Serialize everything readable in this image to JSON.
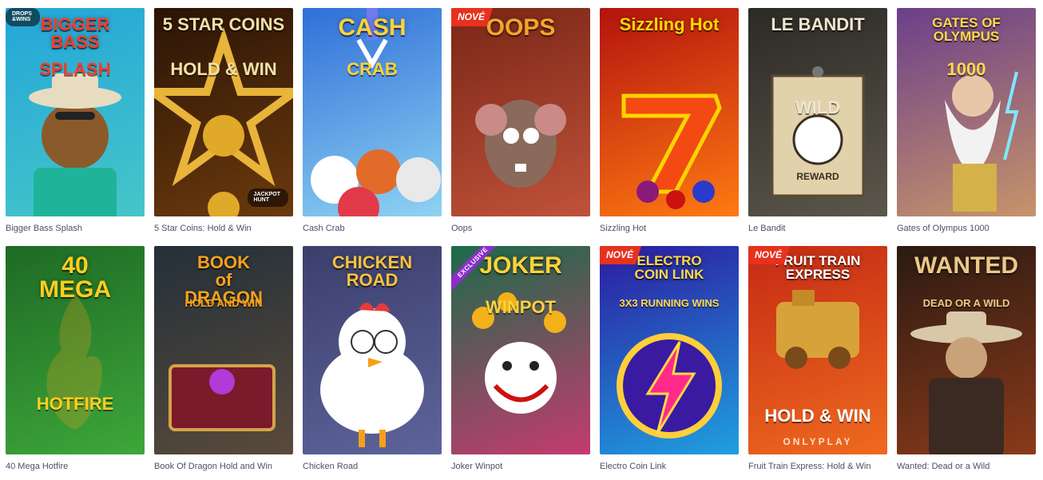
{
  "games": [
    {
      "id": "bigger-bass-splash",
      "name": "Bigger Bass Splash",
      "art_title": "BIGGER\nBASS",
      "art_sub": "SPLASH",
      "badge": "DROPS\n&WINS",
      "bg": "#23a6d9",
      "bg2": "#46c6c9",
      "title_color": "#f63d2b",
      "icon": "fisherman-icon"
    },
    {
      "id": "5-star-coins",
      "name": "5 Star Coins: Hold & Win",
      "art_title": "5 STAR COINS",
      "art_sub": "HOLD & WIN",
      "badge": "JACKPOT\nHUNT",
      "bg": "#2b1406",
      "bg2": "#6b3a0d",
      "title_color": "#f1e0a6",
      "icon": "star-icon"
    },
    {
      "id": "cash-crab",
      "name": "Cash Crab",
      "art_title": "CASH",
      "art_sub": "CRAB",
      "bg": "#2f6fd8",
      "bg2": "#8fd3f2",
      "title_color": "#ffd23a",
      "icon": "claw-icon"
    },
    {
      "id": "oops",
      "name": "Oops",
      "art_title": "OOPS",
      "badge": "NOVÉ",
      "bg": "#7a2616",
      "bg2": "#c0523a",
      "title_color": "#f2a52c",
      "icon": "rat-icon"
    },
    {
      "id": "sizzling-hot",
      "name": "Sizzling Hot",
      "art_title": "Sizzling Hot",
      "bg": "#b3130e",
      "bg2": "#ff7a12",
      "title_color": "#ffd600",
      "icon": "seven-icon"
    },
    {
      "id": "le-bandit",
      "name": "Le Bandit",
      "art_title": "LE BANDIT",
      "art_sub": "WILD",
      "art_sub2": "REWARD",
      "bg": "#2c2a25",
      "bg2": "#5b574c",
      "title_color": "#f0e6d0",
      "icon": "wanted-poster-icon"
    },
    {
      "id": "gates-of-olympus-1000",
      "name": "Gates of Olympus 1000",
      "art_title": "GATES OF OLYMPUS",
      "art_sub": "1000",
      "bg": "#6b3f8a",
      "bg2": "#c7946a",
      "title_color": "#ffd84a",
      "icon": "zeus-icon"
    },
    {
      "id": "40-mega-hotfire",
      "name": "40 Mega Hotfire",
      "art_title": "40\nMEGA",
      "art_sub": "HOTFIRE",
      "bg": "#1e6a25",
      "bg2": "#3ea73a",
      "title_color": "#ffce1f",
      "icon": "fire-icon"
    },
    {
      "id": "book-of-dragon",
      "name": "Book Of Dragon Hold and Win",
      "art_title": "BOOK\nof\nDRAGON",
      "art_sub": "HOLD AND WIN",
      "bg": "#23303a",
      "bg2": "#5a4a3a",
      "title_color": "#f7a21b",
      "icon": "book-icon"
    },
    {
      "id": "chicken-road",
      "name": "Chicken Road",
      "art_title": "CHICKEN\nROAD",
      "bg": "#3b3f6c",
      "bg2": "#5e649b",
      "title_color": "#f8c23d",
      "icon": "chicken-icon"
    },
    {
      "id": "joker-winpot",
      "name": "Joker Winpot",
      "art_title": "JOKER",
      "art_sub": "WINPOT",
      "badge": "EXCLUSIVE",
      "bg": "#1c6b4a",
      "bg2": "#c43b6f",
      "title_color": "#ffd23a",
      "icon": "joker-icon"
    },
    {
      "id": "electro-coin-link",
      "name": "Electro Coin Link",
      "art_title": "ELECTRO\nCOIN LINK",
      "art_sub": "3X3 RUNNING WINS",
      "badge": "NOVÉ",
      "bg": "#2c1aa0",
      "bg2": "#1fa0e0",
      "title_color": "#ffd84a",
      "icon": "lightning-icon"
    },
    {
      "id": "fruit-train-express",
      "name": "Fruit Train Express: Hold & Win",
      "art_title": "FRUIT TRAIN\nEXPRESS",
      "art_sub": "HOLD & WIN",
      "art_sub2": "ONLYPLAY",
      "badge": "NOVÉ",
      "bg": "#c42a14",
      "bg2": "#ef6a1f",
      "title_color": "#ffffff",
      "icon": "train-icon"
    },
    {
      "id": "wanted-dead-or-a-wild",
      "name": "Wanted: Dead or a Wild",
      "art_title": "WANTED",
      "art_sub": "DEAD OR A WILD",
      "bg": "#2b1a12",
      "bg2": "#8a3a1a",
      "title_color": "#e9c98a",
      "icon": "cowboy-icon"
    }
  ]
}
